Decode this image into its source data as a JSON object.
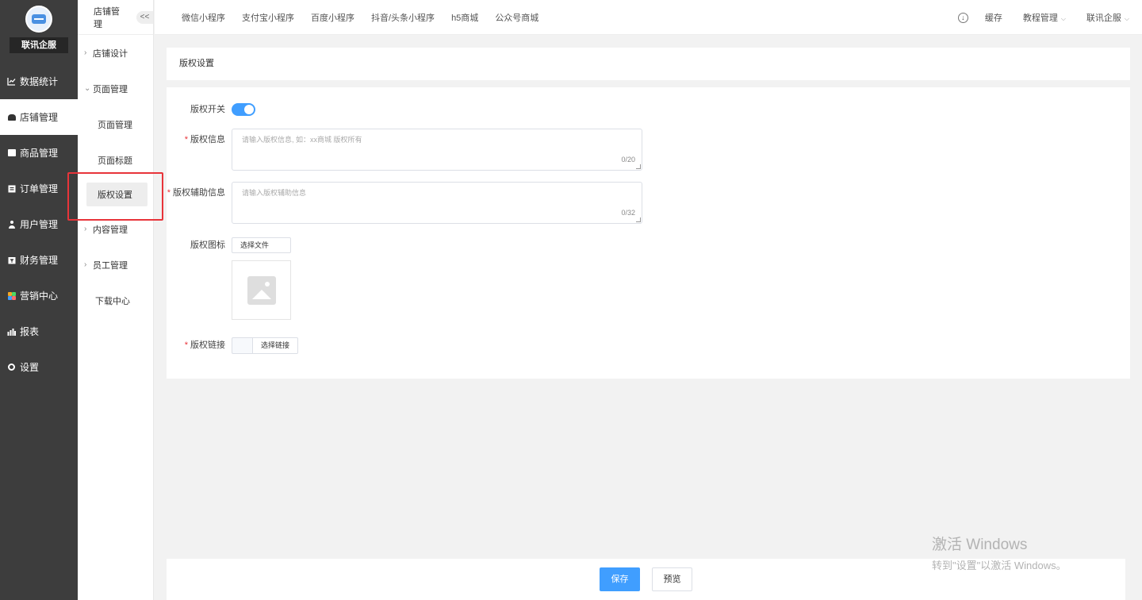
{
  "sidebar": {
    "brand": "联讯企服",
    "items": [
      {
        "label": "数据统计",
        "icon": "line-chart-icon"
      },
      {
        "label": "店铺管理",
        "icon": "store-icon"
      },
      {
        "label": "商品管理",
        "icon": "product-icon"
      },
      {
        "label": "订单管理",
        "icon": "order-icon"
      },
      {
        "label": "用户管理",
        "icon": "user-icon"
      },
      {
        "label": "财务管理",
        "icon": "finance-icon"
      },
      {
        "label": "营销中心",
        "icon": "marketing-icon"
      },
      {
        "label": "报表",
        "icon": "bar-chart-icon"
      },
      {
        "label": "设置",
        "icon": "gear-icon"
      }
    ],
    "active": "店铺管理"
  },
  "subnav": {
    "title": "店铺管理",
    "collapse_label": "<<",
    "store_design": "店铺设计",
    "page_manage": "页面管理",
    "children": [
      "页面管理",
      "页面标题",
      "版权设置"
    ],
    "content_manage": "内容管理",
    "staff_manage": "员工管理",
    "download_center": "下载中心"
  },
  "topbar": {
    "tabs": [
      "微信小程序",
      "支付宝小程序",
      "百度小程序",
      "抖音/头条小程序",
      "h5商城",
      "公众号商城"
    ],
    "cache": "缓存",
    "tutorial": "教程管理",
    "account": "联讯企服"
  },
  "page": {
    "title": "版权设置"
  },
  "form": {
    "switch_label": "版权开关",
    "switch_on": true,
    "info_label": "版权信息",
    "info_placeholder": "请输入版权信息, 如：xx商城 版权所有",
    "info_counter": "0/20",
    "aux_label": "版权辅助信息",
    "aux_placeholder": "请输入版权辅助信息",
    "aux_counter": "0/32",
    "icon_label": "版权图标",
    "choose_file": "选择文件",
    "link_label": "版权链接",
    "choose_link": "选择链接"
  },
  "footer": {
    "save": "保存",
    "preview": "预览"
  },
  "watermark": {
    "line1": "激活 Windows",
    "line2": "转到\"设置\"以激活 Windows。"
  },
  "colors": {
    "accent": "#409eff",
    "sidebar_bg": "#3d3d3d",
    "highlight": "#e8343a"
  }
}
